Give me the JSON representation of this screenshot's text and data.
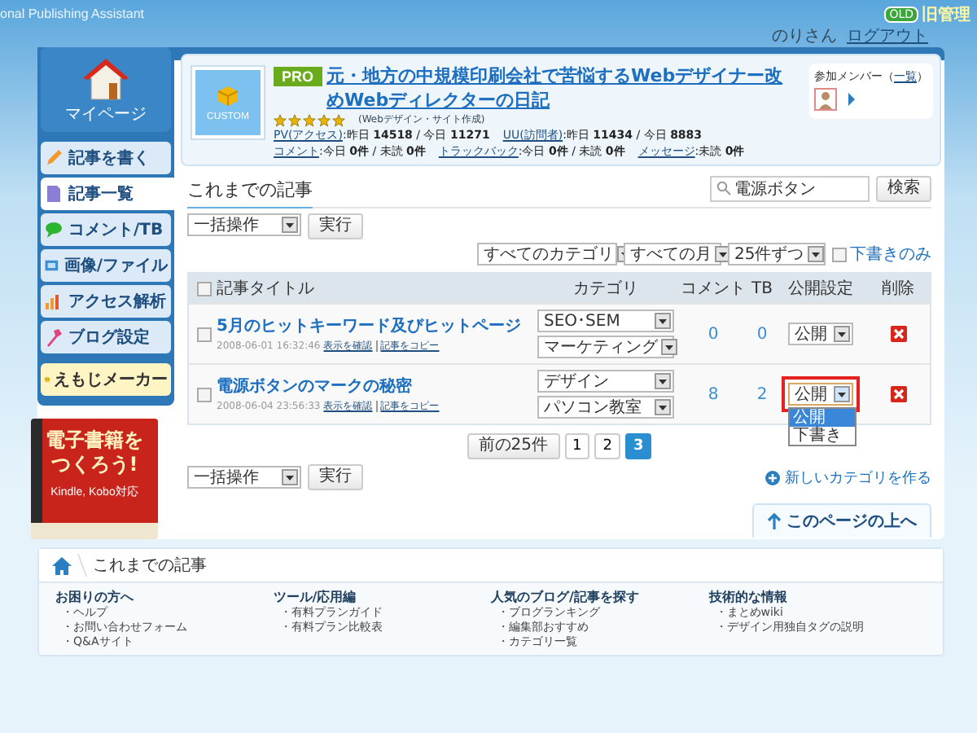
{
  "top_bar": {
    "app_name": "onal Publishing Assistant",
    "old_badge": "OLD",
    "old_link": "旧管理",
    "user": "のりさん",
    "logout": "ログアウト"
  },
  "sidebar": {
    "mypage": "マイページ",
    "items": [
      {
        "label": "記事を書く",
        "selected": false
      },
      {
        "label": "記事一覧",
        "selected": true
      },
      {
        "label": "コメント/TB",
        "selected": false
      },
      {
        "label": "画像/ファイル",
        "selected": false
      },
      {
        "label": "アクセス解析",
        "selected": false
      },
      {
        "label": "ブログ設定",
        "selected": false
      }
    ],
    "emoji_maker": "えもじメーカー",
    "ad": {
      "line1": "電子書籍を",
      "line2": "つくろう!",
      "line3": "Kindle, Kobo対応"
    }
  },
  "blog": {
    "badge": "CUSTOM",
    "plan": "PRO",
    "title": "元・地方の中規模印刷会社で苦悩するWebデザイナー改めWebディレクターの日記",
    "stars": 5,
    "genre": "(Webデザイン・サイト作成)",
    "stats": [
      [
        {
          "label": "PV(アクセス)",
          "value": ":昨日 **14518** / 今日 **11271**"
        },
        {
          "label": "UU(訪問者)",
          "value": ":昨日 **11434** / 今日 **8883**"
        }
      ],
      [
        {
          "label": "コメント",
          "value": ":今日 **0件** / 未読 **0件**"
        },
        {
          "label": "トラックバック",
          "value": ":今日 **0件** / 未読 **0件**"
        },
        {
          "label": "メッセージ",
          "value": ":未読 **0件**"
        }
      ]
    ],
    "members": {
      "label": "参加メンバー（",
      "link": "一覧",
      "close": "）"
    }
  },
  "list": {
    "heading": "これまでの記事",
    "search": {
      "value": "電源ボタン",
      "button": "検索"
    },
    "bulk": {
      "value": "一括操作",
      "button": "実行"
    },
    "filters": [
      "すべてのカテゴリ",
      "すべての月",
      "25件ずつ"
    ],
    "drafts_only": {
      "label": "下書きのみ",
      "checked": false
    },
    "header_checked": false,
    "columns": [
      "記事タイトル",
      "カテゴリ",
      "コメント",
      "TB",
      "公開設定",
      "削除"
    ],
    "rows": [
      {
        "checked": false,
        "title": "5月のヒットキーワード及びヒットページ",
        "date": "2008-06-01 16:32:46",
        "links": [
          "表示を確認",
          "記事をコピー"
        ],
        "categories": [
          "SEO･SEM",
          "マーケティング"
        ],
        "comments": "0",
        "tb": "0",
        "visibility": {
          "value": "公開",
          "open": false,
          "highlighted": false
        }
      },
      {
        "checked": false,
        "title": "電源ボタンのマークの秘密",
        "date": "2008-06-04 23:56:33",
        "links": [
          "表示を確認",
          "記事をコピー"
        ],
        "categories": [
          "デザイン",
          "パソコン教室"
        ],
        "comments": "8",
        "tb": "2",
        "visibility": {
          "value": "公開",
          "open": true,
          "highlighted": true,
          "options": [
            {
              "label": "公開",
              "selected": true
            },
            {
              "label": "下書き",
              "selected": false
            }
          ]
        }
      }
    ],
    "pagination": {
      "prev": "前の25件",
      "pages": [
        {
          "label": "1",
          "selected": false
        },
        {
          "label": "2",
          "selected": false
        },
        {
          "label": "3",
          "selected": true
        }
      ]
    },
    "bulk_bottom": {
      "value": "一括操作",
      "button": "実行"
    },
    "new_category": "新しいカテゴリを作る",
    "back_to_top": "このページの上へ"
  },
  "footer": {
    "breadcrumb": "これまでの記事",
    "columns": [
      {
        "title": "お困りの方へ",
        "links": [
          "・ヘルプ",
          "・お問い合わせフォーム",
          "・Q&Aサイト"
        ]
      },
      {
        "title": "ツール/応用編",
        "links": [
          "・有料プランガイド",
          "・有料プラン比較表"
        ]
      },
      {
        "title": "人気のブログ/記事を探す",
        "links": [
          "・ブログランキング",
          "・編集部おすすめ",
          "・カテゴリ一覧"
        ]
      },
      {
        "title": "技術的な情報",
        "links": [
          "・まとめwiki",
          "・デザイン用独自タグの説明"
        ]
      }
    ]
  }
}
